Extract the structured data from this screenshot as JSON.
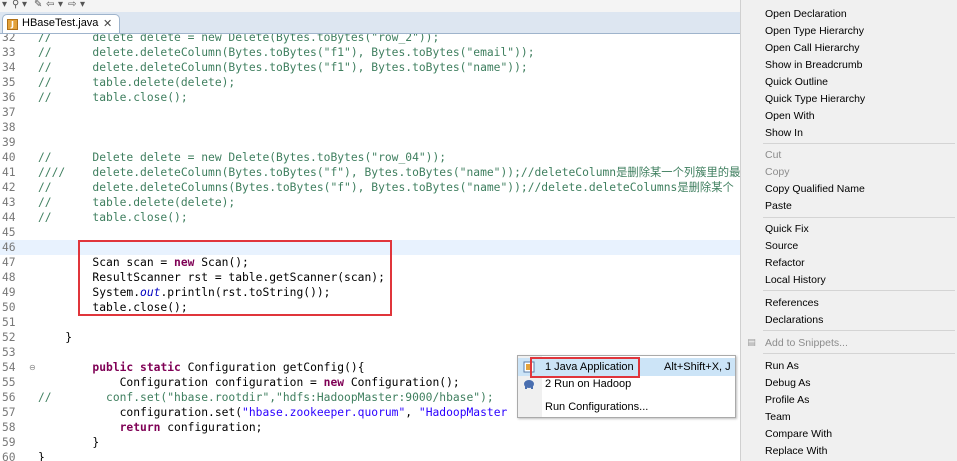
{
  "toolbar": {
    "icons": [
      "dropdown-arrow",
      "pin-icon",
      "back-icon",
      "forward-icon"
    ]
  },
  "editor_tab": {
    "label": "HBaseTest.java",
    "close": "✕"
  },
  "code_lines": [
    {
      "num": "32",
      "cm": "//",
      "text": "      delete delete = new Delete(Bytes.toBytes(\"row_2\"));"
    },
    {
      "num": "33",
      "cm": "//",
      "text": "      delete.deleteColumn(Bytes.toBytes(\"f1\"), Bytes.toBytes(\"email\"));"
    },
    {
      "num": "34",
      "cm": "//",
      "text": "      delete.deleteColumn(Bytes.toBytes(\"f1\"), Bytes.toBytes(\"name\"));"
    },
    {
      "num": "35",
      "cm": "//",
      "text": "      table.delete(delete);"
    },
    {
      "num": "36",
      "cm": "//",
      "text": "      table.close();"
    },
    {
      "num": "37",
      "text": ""
    },
    {
      "num": "38",
      "text": ""
    },
    {
      "num": "39",
      "text": ""
    },
    {
      "num": "40",
      "cm": "//",
      "text": "      Delete delete = new Delete(Bytes.toBytes(\"row_04\"));"
    },
    {
      "num": "41",
      "cm": "////",
      "text": "    delete.deleteColumn(Bytes.toBytes(\"f\"), Bytes.toBytes(\"name\"));//deleteColumn是删除某一个列簇里的最新"
    },
    {
      "num": "42",
      "cm": "//",
      "text": "      delete.deleteColumns(Bytes.toBytes(\"f\"), Bytes.toBytes(\"name\"));//delete.deleteColumns是删除某个"
    },
    {
      "num": "43",
      "cm": "//",
      "text": "      table.delete(delete);"
    },
    {
      "num": "44",
      "cm": "//",
      "text": "      table.close();"
    },
    {
      "num": "45",
      "text": ""
    },
    {
      "num": "46",
      "text": "",
      "current": true
    },
    {
      "num": "47",
      "text": "        Scan scan = new Scan();"
    },
    {
      "num": "48",
      "text": "        ResultScanner rst = table.getScanner(scan);"
    },
    {
      "num": "49",
      "text": "        System.out.println(rst.toString());"
    },
    {
      "num": "50",
      "text": "        table.close();"
    },
    {
      "num": "51",
      "text": ""
    },
    {
      "num": "52",
      "text": "    }"
    },
    {
      "num": "53",
      "text": ""
    },
    {
      "num": "54",
      "text": "        public static Configuration getConfig(){",
      "fold": true
    },
    {
      "num": "55",
      "text": "            Configuration configuration = new Configuration();"
    },
    {
      "num": "56",
      "cm": "//",
      "text": "        conf.set(\"hbase.rootdir\",\"hdfs:HadoopMaster:9000/hbase\");"
    },
    {
      "num": "57",
      "text": "            configuration.set(\"hbase.zookeeper.quorum\", \"HadoopMaster"
    },
    {
      "num": "58",
      "text": "            return configuration;"
    },
    {
      "num": "59",
      "text": "        }"
    },
    {
      "num": "60",
      "text": "}"
    }
  ],
  "run_as_submenu": {
    "items": [
      {
        "label": "1 Java Application",
        "accel": "Alt+Shift+X, J"
      },
      {
        "label": "2 Run on Hadoop",
        "accel": ""
      },
      {
        "label": "Run Configurations...",
        "accel": ""
      }
    ]
  },
  "context_menu": {
    "items": [
      {
        "label": "Open Declaration"
      },
      {
        "label": "Open Type Hierarchy"
      },
      {
        "label": "Open Call Hierarchy"
      },
      {
        "label": "Show in Breadcrumb"
      },
      {
        "label": "Quick Outline"
      },
      {
        "label": "Quick Type Hierarchy"
      },
      {
        "label": "Open With"
      },
      {
        "label": "Show In"
      },
      {
        "label": "Cut",
        "disabled": true
      },
      {
        "label": "Copy",
        "disabled": true
      },
      {
        "label": "Copy Qualified Name"
      },
      {
        "label": "Paste"
      },
      {
        "label": "Quick Fix"
      },
      {
        "label": "Source"
      },
      {
        "label": "Refactor"
      },
      {
        "label": "Local History"
      },
      {
        "label": "References"
      },
      {
        "label": "Declarations"
      },
      {
        "label": "Add to Snippets...",
        "disabled": true
      },
      {
        "label": "Run As"
      },
      {
        "label": "Debug As"
      },
      {
        "label": "Profile As"
      },
      {
        "label": "Team"
      },
      {
        "label": "Compare With"
      },
      {
        "label": "Replace With"
      }
    ]
  }
}
